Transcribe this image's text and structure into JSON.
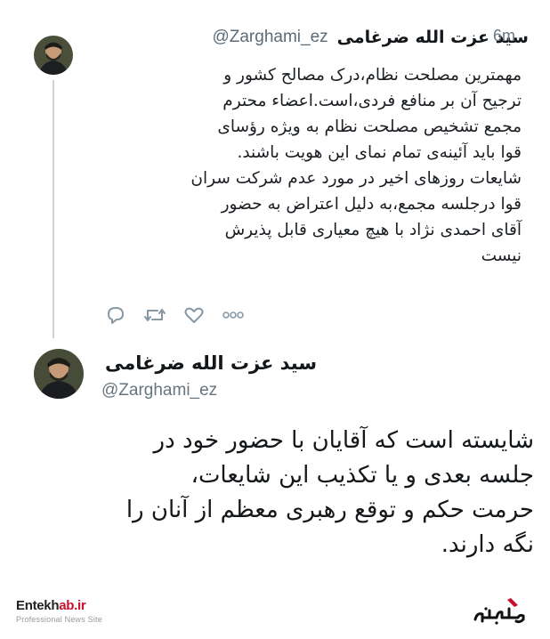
{
  "tweet1": {
    "author_name": "سید عزت الله ضرغامی",
    "handle": "@Zarghami_ez",
    "time": "6m",
    "lines": [
      "مهمترین مصلحت نظام،درک مصالح کشور و",
      "ترجیح آن بر منافع فردی،است.اعضاء محترم",
      "مجمع تشخیص مصلحت نظام به ویژه رؤسای",
      "قوا باید آئینه‌ی تمام نمای این هویت باشند.",
      "شایعات روزهای اخیر در مورد عدم شرکت سران",
      "قوا درجلسه مجمع،به دلیل اعتراض به حضور",
      "آقای احمدی نژاد با هیچ معیاری قابل پذیرش",
      "نیست"
    ],
    "actions": {
      "reply_icon": "reply-icon",
      "retweet_icon": "retweet-icon",
      "like_icon": "heart-icon",
      "more_icon": "more-icon"
    }
  },
  "tweet2": {
    "author_name": "سید عزت الله ضرغامی",
    "handle": "@Zarghami_ez",
    "lines": [
      "شایسته است که آقایان با حضور خود در",
      "جلسه بعدی و یا تکذیب این شایعات،",
      "حرمت حکم و توقع رهبری معظم از آنان را",
      "نگه دارند."
    ]
  },
  "footer": {
    "watermark_part1": "Entekh",
    "watermark_part2": "ab.ir",
    "watermark_sub": "Professional News Site",
    "logo_text": "انتخاب"
  },
  "colors": {
    "text": "#14171a",
    "secondary": "#66757f",
    "thread_line": "#c9d3da",
    "brand_red": "#c8102e"
  }
}
